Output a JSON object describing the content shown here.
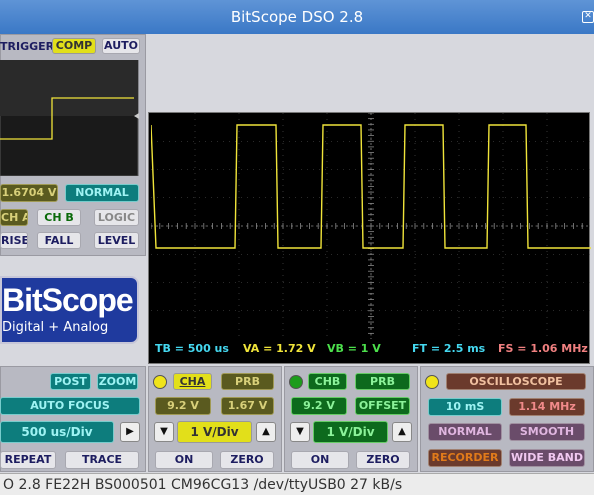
{
  "window": {
    "title": "BitScope DSO 2.8"
  },
  "trigger": {
    "label": "TRIGGER",
    "comp": "COMP",
    "auto": "AUTO",
    "level_value": "1.6704 V",
    "mode": "NORMAL",
    "cha": "CH A",
    "chb": "CH B",
    "logic": "LOGIC",
    "rise": "RISE",
    "fall": "FALL",
    "level": "LEVEL"
  },
  "logo": {
    "name": "BitScope",
    "tagline": "Digital + Analog"
  },
  "scope": {
    "tb": "TB = 500 us",
    "va": "VA = 1.72 V",
    "vb": "VB = 1 V",
    "ft": "FT = 2.5 ms",
    "fs": "FS = 1.06 MHz",
    "colors": {
      "trace": "#f0e43a",
      "bg": "#000000",
      "grid": "#555555"
    }
  },
  "timebase": {
    "post": "POST",
    "zoom": "ZOOM",
    "autofocus": "AUTO FOCUS",
    "value": "500 us/Div",
    "repeat": "REPEAT",
    "trace": "TRACE"
  },
  "channel_a": {
    "name": "CHA",
    "probe": "PRB",
    "range": "9.2 V",
    "offset": "1.67 V",
    "volts": "1 V/Div",
    "on": "ON",
    "zero": "ZERO"
  },
  "channel_b": {
    "name": "CHB",
    "probe": "PRB",
    "range": "9.2 V",
    "offset": "OFFSET",
    "volts": "1 V/Div",
    "on": "ON",
    "zero": "ZERO"
  },
  "mode_panel": {
    "mode": "OSCILLOSCOPE",
    "duration": "10 mS",
    "rate": "1.14 MHz",
    "normal": "NORMAL",
    "smooth": "SMOOTH",
    "recorder": "RECORDER",
    "wideband": "WIDE BAND"
  },
  "statusbar": {
    "text": "O 2.8 FE22H BS000501 CM96CG13 /dev/ttyUSB0 27 kB/s"
  }
}
